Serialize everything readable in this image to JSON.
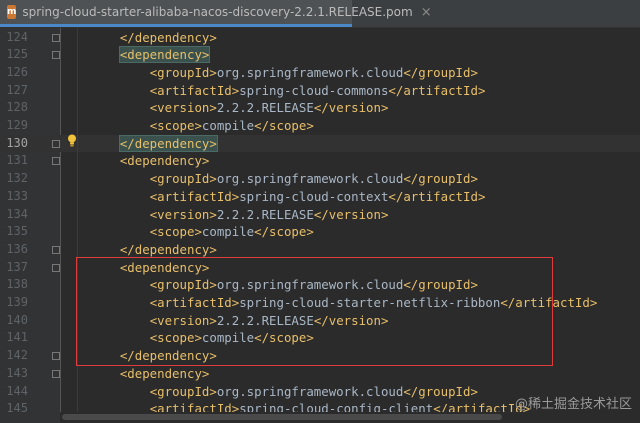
{
  "tab": {
    "icon_letter": "m",
    "title": "spring-cloud-starter-alibaba-nacos-discovery-2.2.1.RELEASE.pom",
    "close_glyph": "×"
  },
  "current_line": 130,
  "lines": [
    {
      "n": "124",
      "parts": [
        [
          "    ",
          "t"
        ],
        [
          "</dependency>",
          "g"
        ]
      ]
    },
    {
      "n": "125",
      "parts": [
        [
          "    ",
          "t"
        ],
        [
          "<dependency>",
          "g"
        ]
      ]
    },
    {
      "n": "126",
      "parts": [
        [
          "        ",
          "t"
        ],
        [
          "<groupId>",
          "g"
        ],
        [
          "org.springframework.cloud",
          "t"
        ],
        [
          "</groupId>",
          "g"
        ]
      ]
    },
    {
      "n": "127",
      "parts": [
        [
          "        ",
          "t"
        ],
        [
          "<artifactId>",
          "g"
        ],
        [
          "spring-cloud-commons",
          "t"
        ],
        [
          "</artifactId>",
          "g"
        ]
      ]
    },
    {
      "n": "128",
      "parts": [
        [
          "        ",
          "t"
        ],
        [
          "<version>",
          "g"
        ],
        [
          "2.2.2.RELEASE",
          "t"
        ],
        [
          "</version>",
          "g"
        ]
      ]
    },
    {
      "n": "129",
      "parts": [
        [
          "        ",
          "t"
        ],
        [
          "<scope>",
          "g"
        ],
        [
          "compile",
          "t"
        ],
        [
          "</scope>",
          "g"
        ]
      ]
    },
    {
      "n": "130",
      "parts": [
        [
          "    ",
          "t"
        ],
        [
          "</dependency>",
          "g"
        ]
      ]
    },
    {
      "n": "131",
      "parts": [
        [
          "    ",
          "t"
        ],
        [
          "<dependency>",
          "g"
        ]
      ]
    },
    {
      "n": "132",
      "parts": [
        [
          "        ",
          "t"
        ],
        [
          "<groupId>",
          "g"
        ],
        [
          "org.springframework.cloud",
          "t"
        ],
        [
          "</groupId>",
          "g"
        ]
      ]
    },
    {
      "n": "133",
      "parts": [
        [
          "        ",
          "t"
        ],
        [
          "<artifactId>",
          "g"
        ],
        [
          "spring-cloud-context",
          "t"
        ],
        [
          "</artifactId>",
          "g"
        ]
      ]
    },
    {
      "n": "134",
      "parts": [
        [
          "        ",
          "t"
        ],
        [
          "<version>",
          "g"
        ],
        [
          "2.2.2.RELEASE",
          "t"
        ],
        [
          "</version>",
          "g"
        ]
      ]
    },
    {
      "n": "135",
      "parts": [
        [
          "        ",
          "t"
        ],
        [
          "<scope>",
          "g"
        ],
        [
          "compile",
          "t"
        ],
        [
          "</scope>",
          "g"
        ]
      ]
    },
    {
      "n": "136",
      "parts": [
        [
          "    ",
          "t"
        ],
        [
          "</dependency>",
          "g"
        ]
      ]
    },
    {
      "n": "137",
      "parts": [
        [
          "    ",
          "t"
        ],
        [
          "<dependency>",
          "g"
        ]
      ]
    },
    {
      "n": "138",
      "parts": [
        [
          "        ",
          "t"
        ],
        [
          "<groupId>",
          "g"
        ],
        [
          "org.springframework.cloud",
          "t"
        ],
        [
          "</groupId>",
          "g"
        ]
      ]
    },
    {
      "n": "139",
      "parts": [
        [
          "        ",
          "t"
        ],
        [
          "<artifactId>",
          "g"
        ],
        [
          "spring-cloud-starter-netflix-ribbon",
          "t"
        ],
        [
          "</artifactId>",
          "g"
        ]
      ]
    },
    {
      "n": "140",
      "parts": [
        [
          "        ",
          "t"
        ],
        [
          "<version>",
          "g"
        ],
        [
          "2.2.2.RELEASE",
          "t"
        ],
        [
          "</version>",
          "g"
        ]
      ]
    },
    {
      "n": "141",
      "parts": [
        [
          "        ",
          "t"
        ],
        [
          "<scope>",
          "g"
        ],
        [
          "compile",
          "t"
        ],
        [
          "</scope>",
          "g"
        ]
      ]
    },
    {
      "n": "142",
      "parts": [
        [
          "    ",
          "t"
        ],
        [
          "</dependency>",
          "g"
        ]
      ]
    },
    {
      "n": "143",
      "parts": [
        [
          "    ",
          "t"
        ],
        [
          "<dependency>",
          "g"
        ]
      ]
    },
    {
      "n": "144",
      "parts": [
        [
          "        ",
          "t"
        ],
        [
          "<groupId>",
          "g"
        ],
        [
          "org.springframework.cloud",
          "t"
        ],
        [
          "</groupId>",
          "g"
        ]
      ]
    },
    {
      "n": "145",
      "parts": [
        [
          "        ",
          "t"
        ],
        [
          "<artifactId>",
          "g"
        ],
        [
          "spring-cloud-config-client",
          "t"
        ],
        [
          "</artifactId>",
          "g"
        ]
      ]
    }
  ],
  "matched_tag_lines": [
    125,
    130
  ],
  "fold_markers": [
    124,
    125,
    130,
    131,
    136,
    137,
    142,
    143
  ],
  "highlighted_block": {
    "from_line": 137,
    "to_line": 142,
    "color": "#e03c3c"
  },
  "intention_bulb_line": 130,
  "colors": {
    "background": "#2b2b2b",
    "tag": "#e8bf6a",
    "text": "#a9b7c6",
    "line_number": "#606366",
    "tab_accent": "#4a88c7"
  },
  "watermark": "@稀土掘金技术社区"
}
